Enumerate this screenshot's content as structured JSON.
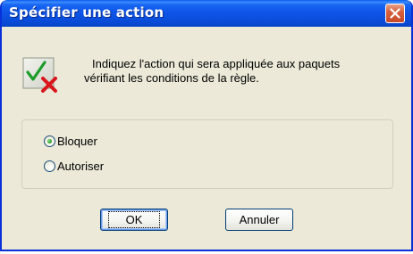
{
  "dialog": {
    "title": "Spécifier une action",
    "message_line1": "Indiquez l'action qui sera appliquée aux paquets",
    "message_line2": "vérifiant les conditions de la règle.",
    "icon": "check-cross-icon"
  },
  "actions": {
    "options": [
      {
        "label": "Bloquer",
        "checked": true
      },
      {
        "label": "Autoriser",
        "checked": false
      }
    ]
  },
  "buttons": {
    "ok_label": "OK",
    "cancel_label": "Annuler"
  },
  "colors": {
    "titlebar": "#0b4fdd",
    "dialog_bg": "#ece9d8",
    "close_button": "#d8603e"
  }
}
